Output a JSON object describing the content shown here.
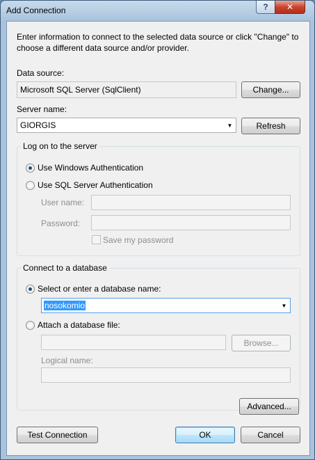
{
  "window": {
    "title": "Add Connection",
    "help_glyph": "?",
    "close_glyph": "✕"
  },
  "intro": "Enter information to connect to the selected data source or click \"Change\" to choose a different data source and/or provider.",
  "data_source": {
    "label": "Data source:",
    "value": "Microsoft SQL Server (SqlClient)",
    "change_label": "Change..."
  },
  "server": {
    "label": "Server name:",
    "value": "GIORGIS",
    "refresh_label": "Refresh"
  },
  "logon": {
    "legend": "Log on to the server",
    "windows_auth": "Use Windows Authentication",
    "sql_auth": "Use SQL Server Authentication",
    "user_label": "User name:",
    "user_value": "",
    "password_label": "Password:",
    "password_value": "",
    "save_password": "Save my password",
    "selected": "windows"
  },
  "database": {
    "legend": "Connect to a database",
    "select_label": "Select or enter a database name:",
    "name_value": "nosokomio",
    "attach_label": "Attach a database file:",
    "attach_value": "",
    "browse_label": "Browse...",
    "logical_label": "Logical name:",
    "logical_value": "",
    "selected": "select"
  },
  "buttons": {
    "advanced": "Advanced...",
    "test": "Test Connection",
    "ok": "OK",
    "cancel": "Cancel"
  },
  "icons": {
    "dropdown": "▼"
  },
  "colors": {
    "selection": "#3399ff",
    "close_button": "#c8442f"
  }
}
